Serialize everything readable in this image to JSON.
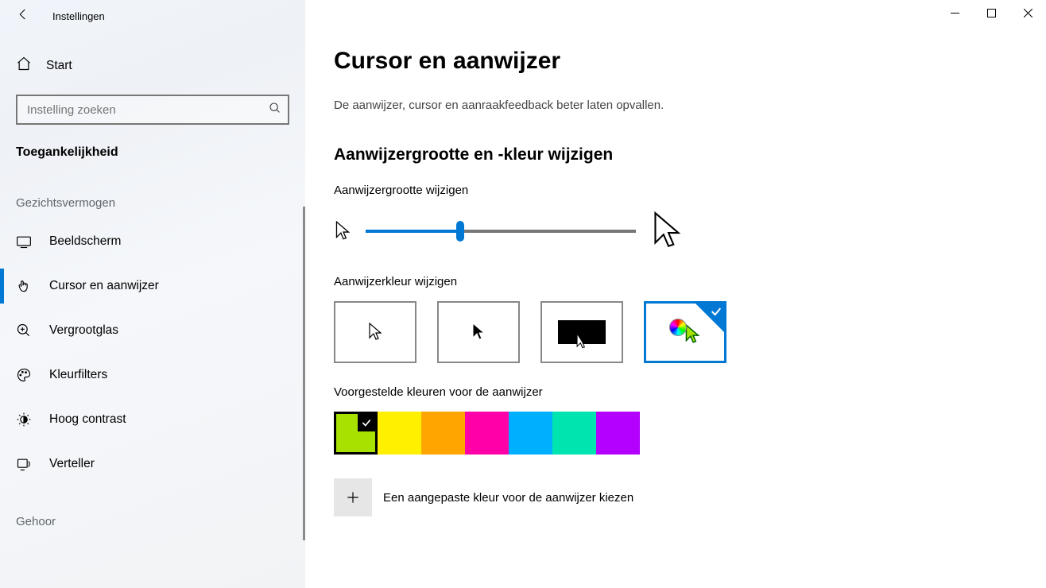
{
  "window": {
    "title": "Instellingen"
  },
  "sidebar": {
    "home": "Start",
    "search_placeholder": "Instelling zoeken",
    "section": "Toegankelijkheid",
    "group_vision": "Gezichtsvermogen",
    "group_hearing": "Gehoor",
    "items": [
      {
        "label": "Beeldscherm"
      },
      {
        "label": "Cursor en aanwijzer"
      },
      {
        "label": "Vergrootglas"
      },
      {
        "label": "Kleurfilters"
      },
      {
        "label": "Hoog contrast"
      },
      {
        "label": "Verteller"
      }
    ]
  },
  "main": {
    "title": "Cursor en aanwijzer",
    "subtitle": "De aanwijzer, cursor en aanraakfeedback beter laten opvallen.",
    "section_size_color": "Aanwijzergrootte en -kleur wijzigen",
    "label_size": "Aanwijzergrootte wijzigen",
    "label_color": "Aanwijzerkleur wijzigen",
    "label_swatches": "Voorgestelde kleuren voor de aanwijzer",
    "custom_label": "Een aangepaste kleur voor de aanwijzer kiezen"
  },
  "colors": {
    "swatches": [
      "#A8E100",
      "#FFF000",
      "#FFA500",
      "#FF00A8",
      "#00B0FF",
      "#00E5B0",
      "#B400FF"
    ],
    "selected_swatch_index": 0,
    "selected_mode_index": 3
  },
  "slider": {
    "percent": 35
  }
}
